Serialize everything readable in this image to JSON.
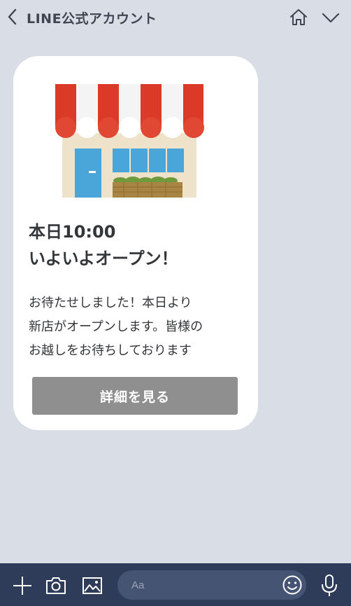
{
  "header": {
    "title": "LINE公式アカウント",
    "back_icon": "chevron-left-icon",
    "home_icon": "home-icon",
    "menu_icon": "chevron-down-icon"
  },
  "card": {
    "image": "shop-storefront-illustration",
    "headline_lines": [
      "本日10:00",
      "いよいよオープン！"
    ],
    "body_lines": [
      "お待たせしました！本日より",
      "新店がオープンします。皆様の",
      "お越しをお待ちしております"
    ],
    "button_label": "詳細を見る",
    "button_color": "#8f8f8f"
  },
  "footer": {
    "input_placeholder": "Aa",
    "icons": [
      "plus-icon",
      "camera-icon",
      "image-icon",
      "emoji-icon",
      "microphone-icon"
    ]
  },
  "colors": {
    "background": "#d8dde6",
    "footer": "#2f3c59",
    "card": "#ffffff",
    "awning_red": "#dc3a28",
    "window_blue": "#4aa6d8"
  }
}
